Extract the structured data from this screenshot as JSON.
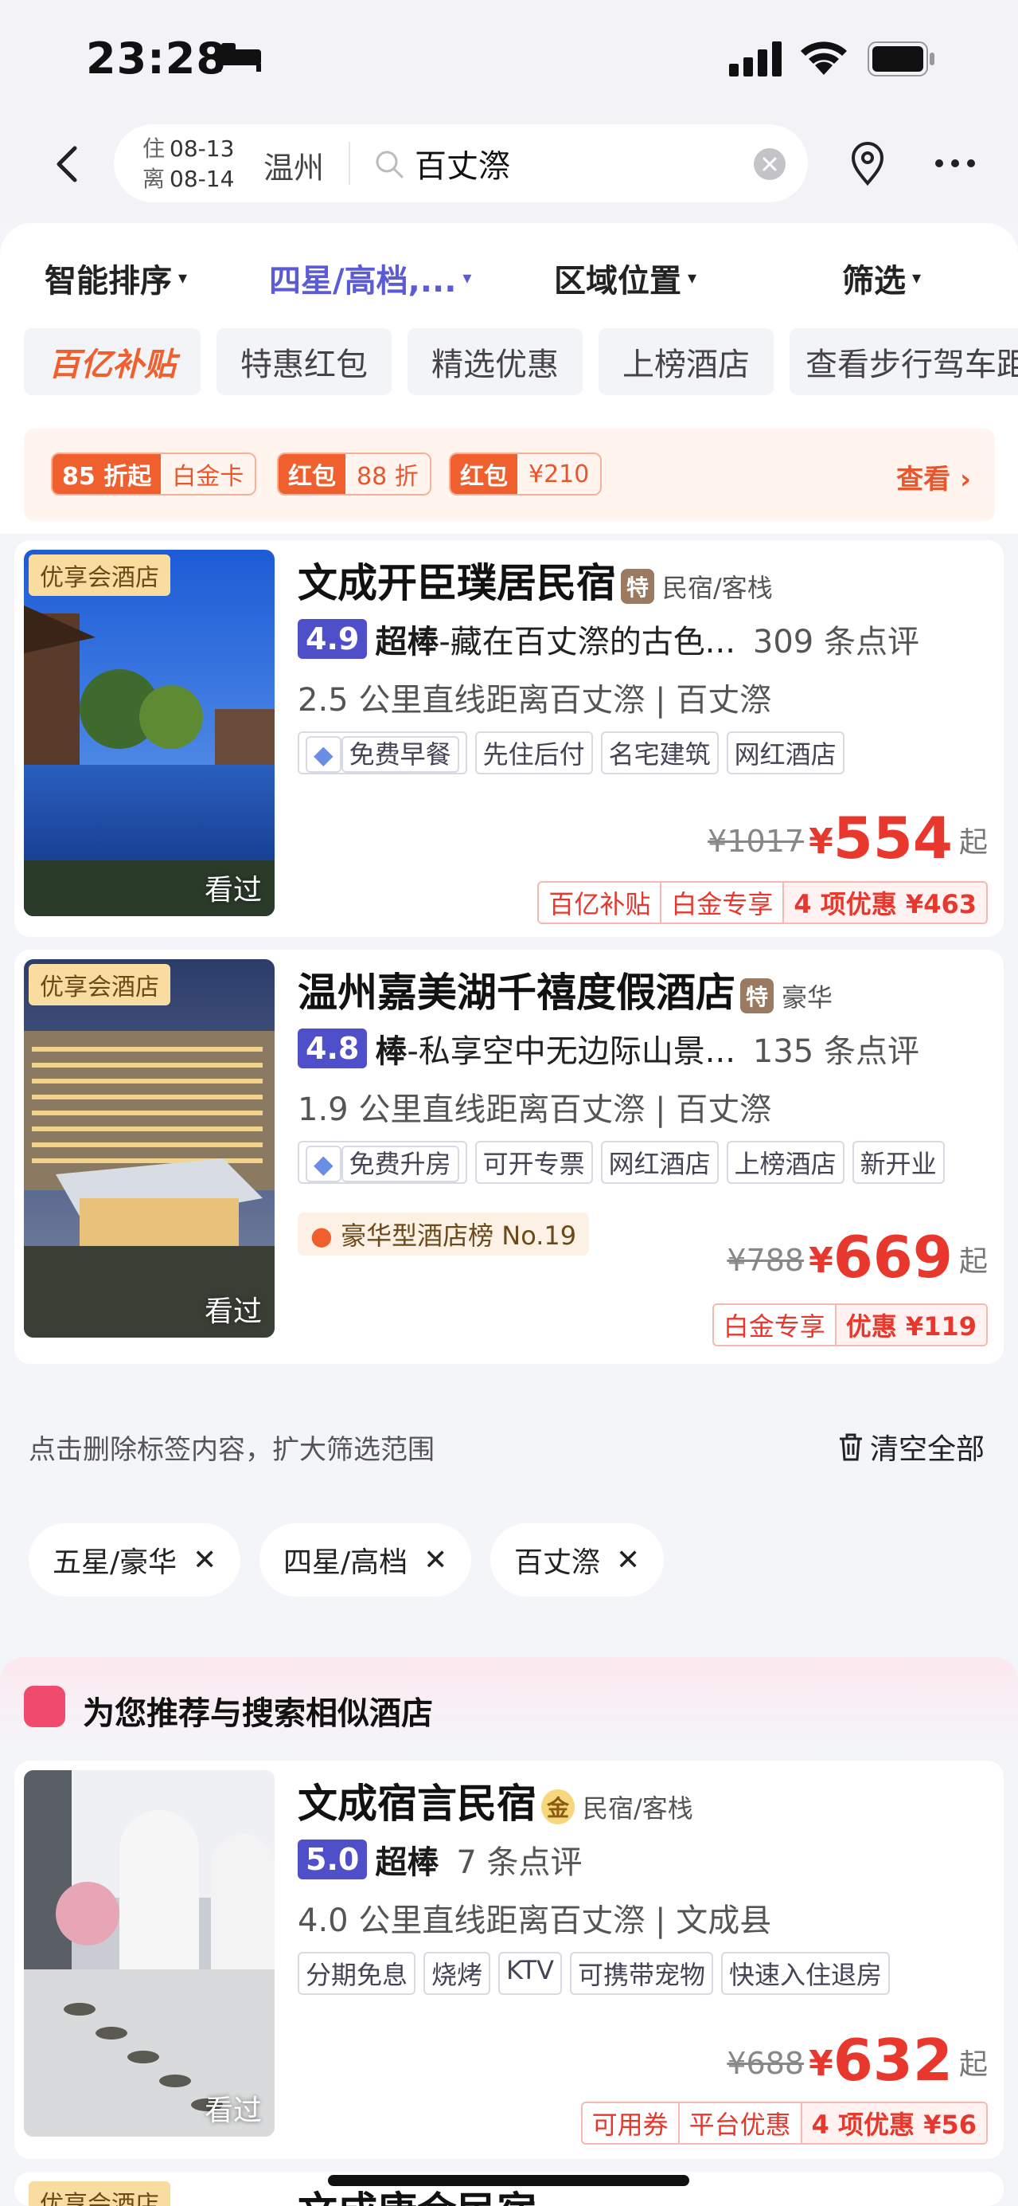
{
  "status_bar": {
    "time": "23:28"
  },
  "search": {
    "checkin_label": "住",
    "checkin_date": "08-13",
    "checkout_label": "离",
    "checkout_date": "08-14",
    "city": "温州",
    "query": "百丈漈"
  },
  "sort_bar": {
    "sort": "智能排序",
    "star": "四星/高档,...",
    "area": "区域位置",
    "filter": "筛选"
  },
  "quick_chips": [
    "百亿补贴",
    "特惠红包",
    "精选优惠",
    "上榜酒店",
    "查看步行驾车距"
  ],
  "promo": {
    "tags": [
      {
        "a": "85 折起",
        "b": "白金卡"
      },
      {
        "a": "红包",
        "b": "88 折"
      },
      {
        "a": "红包",
        "b": "¥210"
      }
    ],
    "view": "查看"
  },
  "hotels": [
    {
      "badge": "优享会酒店",
      "name": "文成开臣璞居民宿",
      "type_icon": "特",
      "type": "民宿/客栈",
      "score": "4.9",
      "level": "超棒",
      "desc": "-藏在百丈漈的古色...",
      "reviews": "309 条点评",
      "distance": "2.5 公里直线距离百丈漈 | 百丈漈",
      "amenities": [
        "免费早餐",
        "先住后付",
        "名宅建筑",
        "网红酒店"
      ],
      "orig_price": "¥1017",
      "currency": "¥",
      "price": "554",
      "qi": "起",
      "perks": [
        "百亿补贴",
        "白金专享",
        "4 项优惠 ¥463"
      ],
      "seen": "看过"
    },
    {
      "badge": "优享会酒店",
      "name": "温州嘉美湖千禧度假酒店",
      "type_icon": "特",
      "type": "豪华",
      "score": "4.8",
      "level": "棒",
      "desc": "-私享空中无边际山景...",
      "reviews": "135 条点评",
      "distance": "1.9 公里直线距离百丈漈 | 百丈漈",
      "amenities": [
        "免费升房",
        "可开专票",
        "网红酒店",
        "上榜酒店",
        "新开业"
      ],
      "rank": "豪华型酒店榜 No.19",
      "orig_price": "¥788",
      "currency": "¥",
      "price": "669",
      "qi": "起",
      "perks": [
        "白金专享",
        "优惠 ¥119"
      ],
      "seen": "看过"
    },
    {
      "name": "文成宿言民宿",
      "type_icon": "金",
      "type": "民宿/客栈",
      "score": "5.0",
      "level": "超棒",
      "desc": "",
      "reviews": "7 条点评",
      "distance": "4.0 公里直线距离百丈漈 | 文成县",
      "amenities": [
        "分期免息",
        "烧烤",
        "KTV",
        "可携带宠物",
        "快速入住退房"
      ],
      "orig_price": "¥688",
      "currency": "¥",
      "price": "632",
      "qi": "起",
      "perks": [
        "可用券",
        "平台优惠",
        "4 项优惠 ¥56"
      ],
      "seen": "看过"
    }
  ],
  "tip": {
    "text": "点击删除标签内容，扩大筛选范围",
    "clear_all": "清空全部"
  },
  "filter_tags": [
    "五星/豪华",
    "四星/高档",
    "百丈漈"
  ],
  "recommend": {
    "title": "为您推荐与搜索相似酒店"
  },
  "partial_badge": "优享会酒店",
  "partial_name": "文成康会民宿"
}
